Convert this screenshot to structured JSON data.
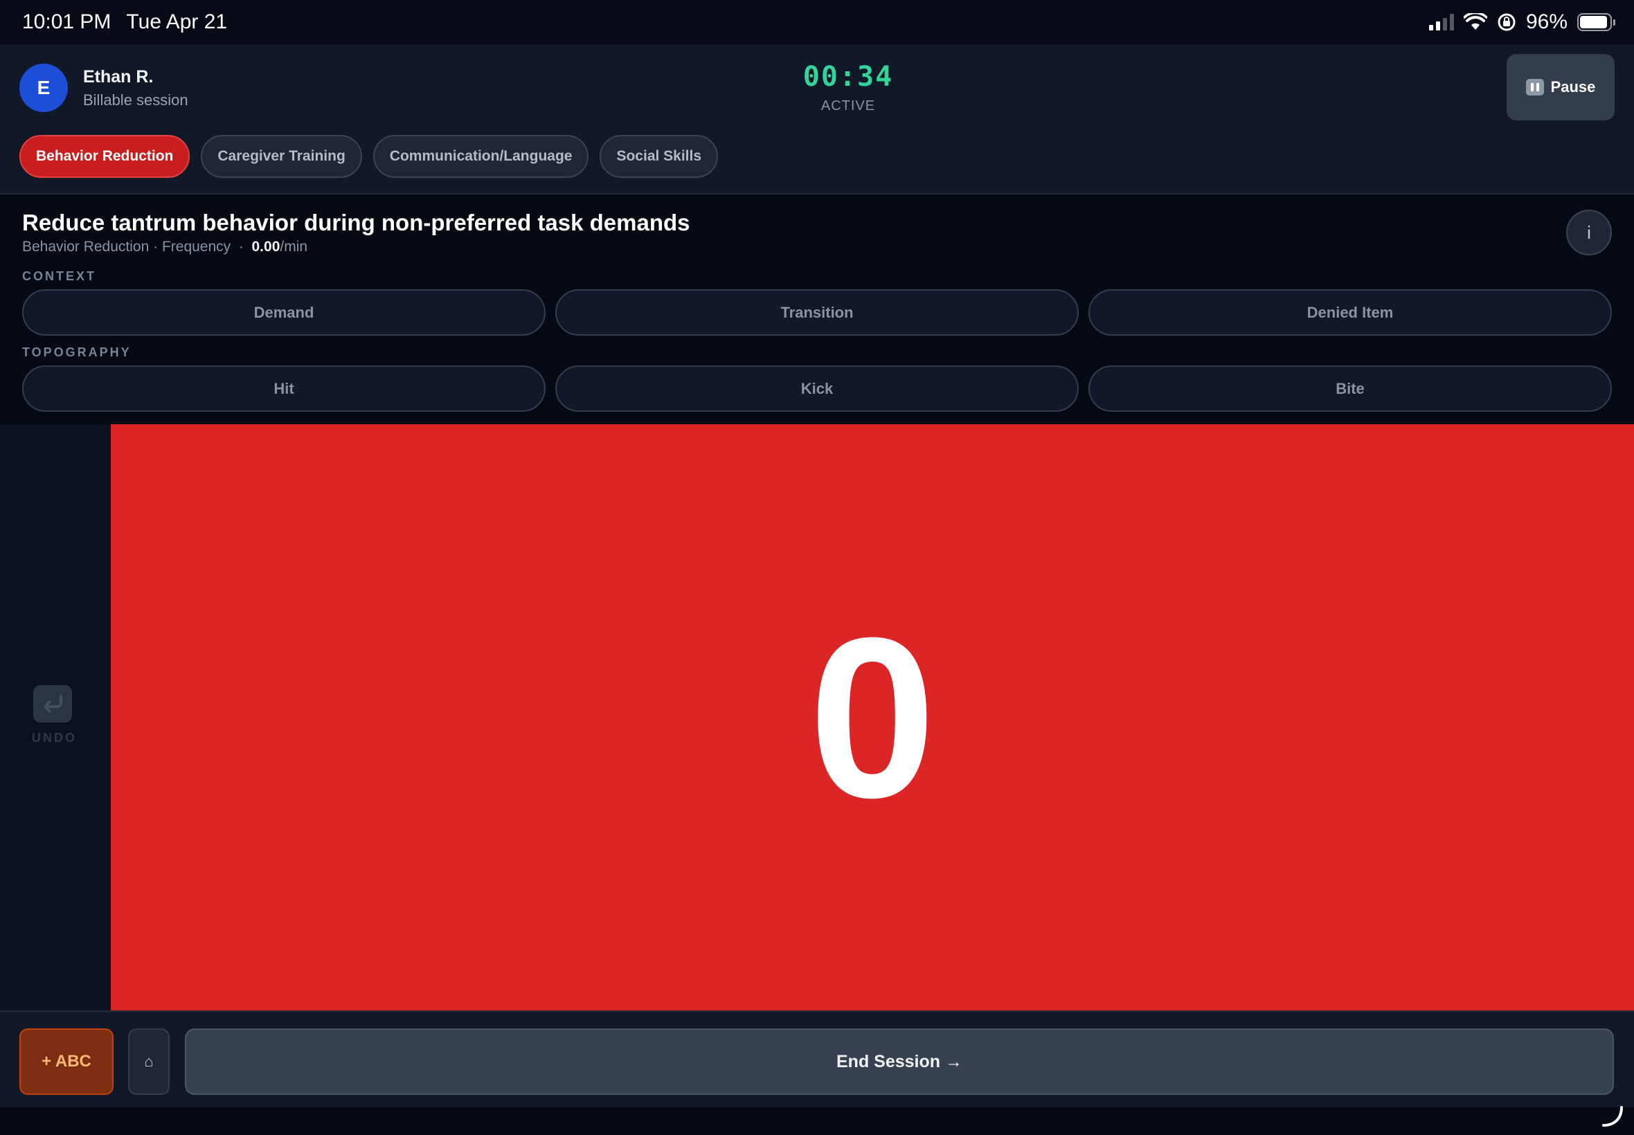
{
  "status_bar": {
    "time": "10:01 PM",
    "date": "Tue Apr 21",
    "battery": "96%"
  },
  "header": {
    "avatar_initial": "E",
    "user_name": "Ethan R.",
    "user_sub": "Billable session",
    "timer": "00:34",
    "timer_status": "ACTIVE",
    "pause_label": "Pause"
  },
  "tabs": [
    {
      "label": "Behavior Reduction",
      "active": true
    },
    {
      "label": "Caregiver Training",
      "active": false
    },
    {
      "label": "Communication/Language",
      "active": false
    },
    {
      "label": "Social Skills",
      "active": false
    }
  ],
  "goal": {
    "title": "Reduce tantrum behavior during non-preferred task demands",
    "meta_prefix": "Behavior Reduction · Frequency  ·  ",
    "rate_value": "0.00",
    "rate_unit": "/min",
    "info_label": "i"
  },
  "context": {
    "label": "CONTEXT",
    "options": [
      "Demand",
      "Transition",
      "Denied Item"
    ]
  },
  "topography": {
    "label": "TOPOGRAPHY",
    "options": [
      "Hit",
      "Kick",
      "Bite"
    ]
  },
  "counter": {
    "undo_label": "UNDO",
    "count": "0",
    "color": "#dc2626"
  },
  "bottom": {
    "abc_label": "+ ABC",
    "home_label": "⌂",
    "end_label": "End Session →"
  }
}
